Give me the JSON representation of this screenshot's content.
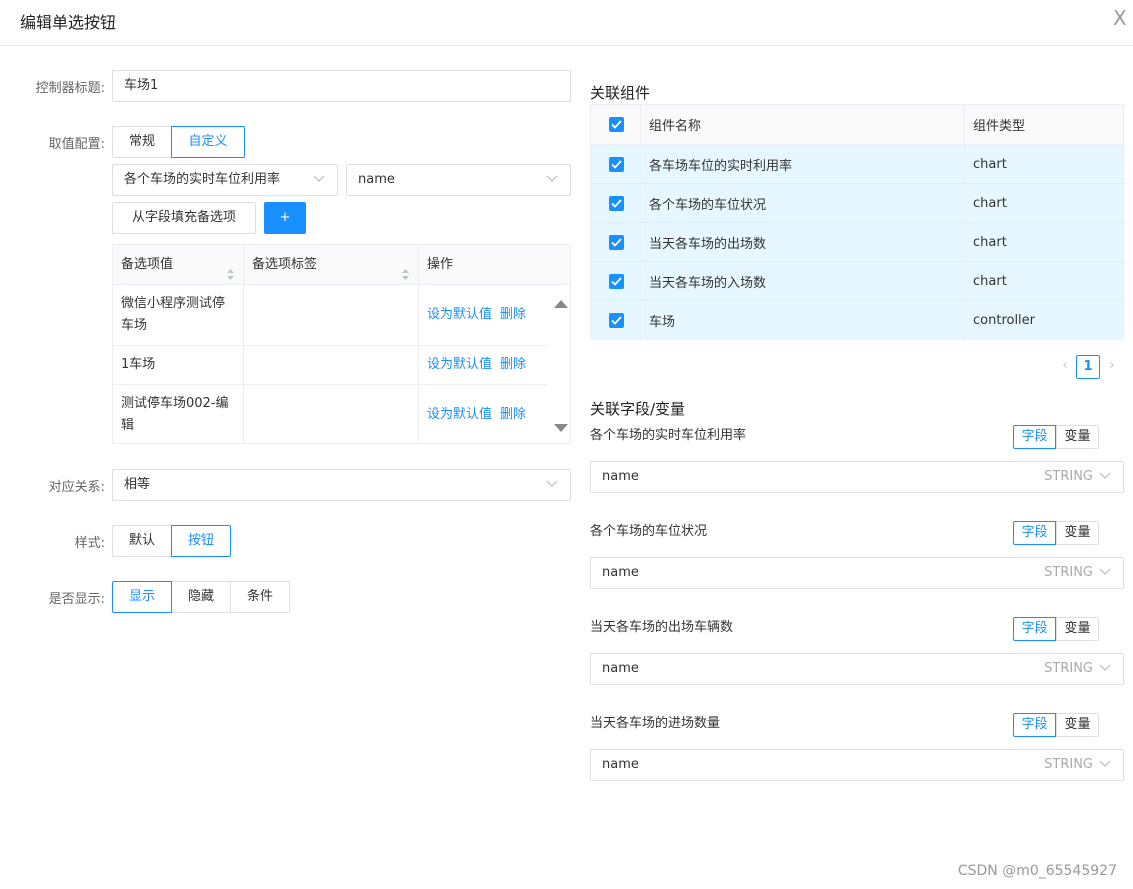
{
  "dialog": {
    "title": "编辑单选按钮",
    "close": "X"
  },
  "left": {
    "title_label": "控制器标题:",
    "title_value": "车场1",
    "value_label": "取值配置:",
    "value_tabs": [
      "常规",
      "自定义"
    ],
    "source_select": "各个车场的实时车位利用率",
    "field_select": "name",
    "fill_button": "从字段填充备选项",
    "add_button": "+",
    "table": {
      "headers": [
        "备选项值",
        "备选项标签",
        "操作"
      ],
      "rows": [
        {
          "value": "微信小程序测试停车场",
          "label": ""
        },
        {
          "value": "1车场",
          "label": ""
        },
        {
          "value": "测试停车场002-编辑",
          "label": ""
        }
      ],
      "action_default": "设为默认值",
      "action_delete": "删除"
    },
    "relation_label": "对应关系:",
    "relation_value": "相等",
    "style_label": "样式:",
    "style_options": [
      "默认",
      "按钮"
    ],
    "display_label": "是否显示:",
    "display_options": [
      "显示",
      "隐藏",
      "条件"
    ]
  },
  "right": {
    "components_title": "关联组件",
    "comp_headers": [
      "组件名称",
      "组件类型"
    ],
    "components": [
      {
        "name": "各车场车位的实时利用率",
        "type": "chart"
      },
      {
        "name": "各个车场的车位状况",
        "type": "chart"
      },
      {
        "name": "当天各车场的出场数",
        "type": "chart"
      },
      {
        "name": "当天各车场的入场数",
        "type": "chart"
      },
      {
        "name": "车场",
        "type": "controller"
      }
    ],
    "pager": {
      "prev": "‹",
      "current": "1",
      "next": "›"
    },
    "fields_title": "关联字段/变量",
    "seg_field": "字段",
    "seg_var": "变量",
    "fields": [
      {
        "label": "各个车场的实时车位利用率",
        "value": "name",
        "type": "STRING"
      },
      {
        "label": "各个车场的车位状况",
        "value": "name",
        "type": "STRING"
      },
      {
        "label": "当天各车场的出场车辆数",
        "value": "name",
        "type": "STRING"
      },
      {
        "label": "当天各车场的进场数量",
        "value": "name",
        "type": "STRING"
      }
    ]
  },
  "watermark": "CSDN @m0_65545927"
}
